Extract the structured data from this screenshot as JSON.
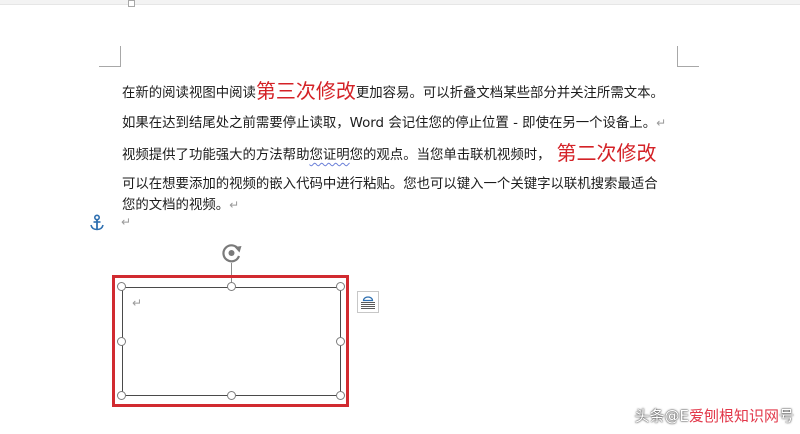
{
  "document": {
    "paragraph1": {
      "before": "在新的阅读视图中阅读",
      "highlight": "第三次修改",
      "after": "更加容易。可以折叠文档某些部分并关注所需文本。"
    },
    "paragraph2": {
      "text": "如果在达到结尾处之前需要停止读取，Word 会记住您的停止位置 - 即使在另一个设备上。",
      "pilcrow": "↵"
    },
    "paragraph3": {
      "before": "视频提供了功能强大的方法帮助",
      "squiggle": "您证明",
      "after": "您的观点。当您单击联机视频时，",
      "highlight": "第二次修改"
    },
    "paragraph4": {
      "line1": "可以在想要添加的视频的嵌入代码中进行粘贴。您也可以键入一个关键字以联机搜索最适合",
      "line2": "您的文档的视频。",
      "pilcrow": "↵"
    },
    "empty_paragraph_pilcrow": "↵",
    "textbox": {
      "pilcrow": "↵"
    }
  },
  "icons": {
    "anchor": "anchor-icon",
    "rotate": "rotate-handle-icon",
    "layout_options": "layout-options-icon"
  },
  "watermark": {
    "base": "头条@E",
    "overlay": "爱刨根知识网",
    "tail": "号"
  },
  "colors": {
    "revision_red": "#d42227",
    "highlight_border": "#d12a30",
    "anchor_blue": "#2e6fb0",
    "pilcrow_gray": "#9a9a9a"
  }
}
